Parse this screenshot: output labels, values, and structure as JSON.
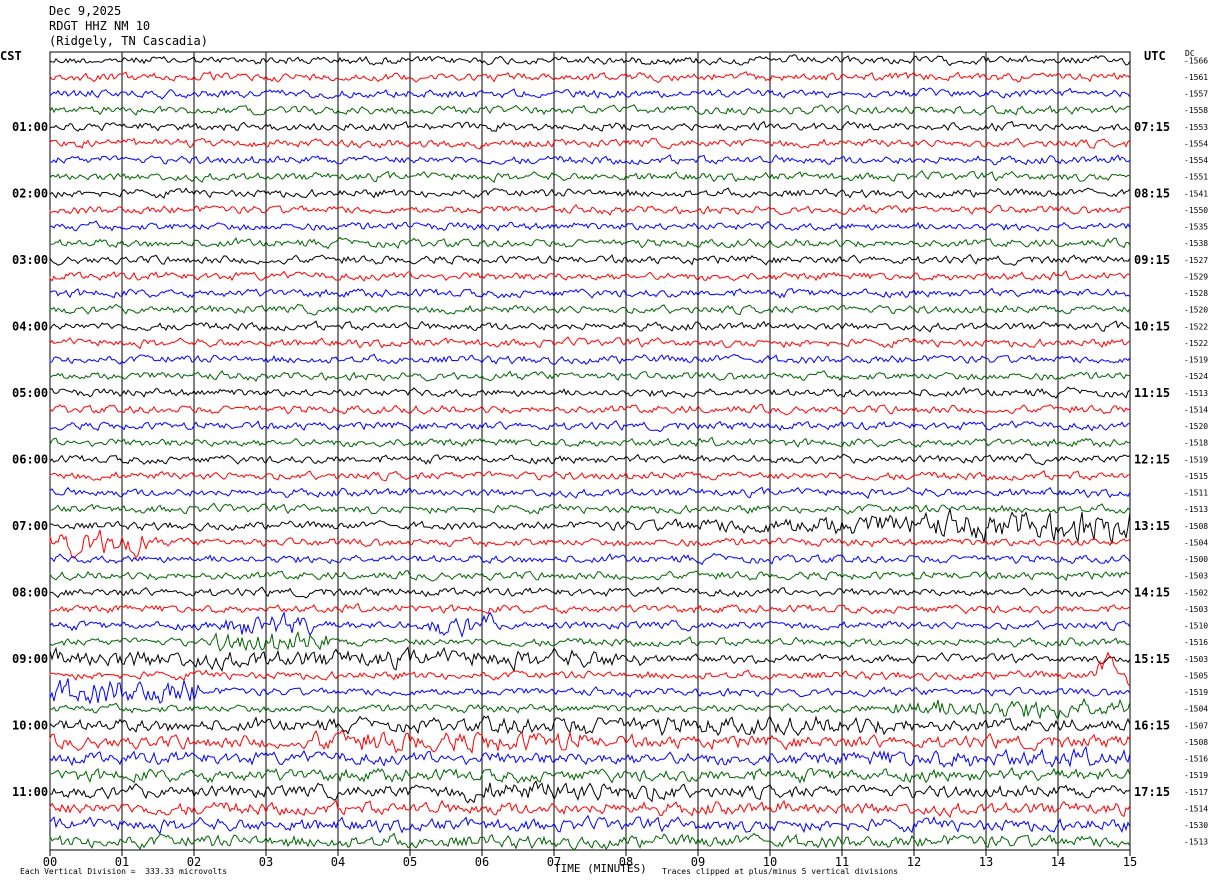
{
  "header": {
    "date": "Dec 9,2025",
    "station": "RDGT HHZ NM 10",
    "location": "(Ridgely, TN Cascadia)"
  },
  "left_zone": "CST",
  "right_zone": "UTC",
  "dc_label": "DC",
  "footer": {
    "left_note": "Each Vertical Division =  333.33 microvolts",
    "axis_title": "TIME (MINUTES)",
    "right_note": "Traces clipped at plus/minus 5 vertical divisions"
  },
  "colors": {
    "cycle": [
      "#000000",
      "#ff0000",
      "#0000ff",
      "#006400"
    ]
  },
  "chart_data": {
    "type": "line",
    "title": "Dec 9,2025 RDGT HHZ NM 10 (Ridgely, TN Cascadia)",
    "xlabel": "TIME (MINUTES)",
    "xlim": [
      0,
      15
    ],
    "x_ticks": [
      "00",
      "01",
      "02",
      "03",
      "04",
      "05",
      "06",
      "07",
      "08",
      "09",
      "10",
      "11",
      "12",
      "13",
      "14",
      "15"
    ],
    "rows_per_hour": 4,
    "row_count": 48,
    "left_hour_labels": [
      "01:00",
      "02:00",
      "03:00",
      "04:00",
      "05:00",
      "06:00",
      "07:00",
      "08:00",
      "09:00",
      "10:00",
      "11:00"
    ],
    "right_hour_labels": [
      "07:15",
      "08:15",
      "09:15",
      "10:15",
      "11:15",
      "12:15",
      "13:15",
      "14:15",
      "15:15",
      "16:15",
      "17:15"
    ],
    "hour_label_rows": [
      4,
      8,
      12,
      16,
      20,
      24,
      28,
      32,
      36,
      40,
      44
    ],
    "dc_offsets": [
      -1566,
      -1561,
      -1557,
      -1558,
      -1553,
      -1554,
      -1554,
      -1551,
      -1541,
      -1550,
      -1535,
      -1538,
      -1527,
      -1529,
      -1528,
      -1520,
      -1522,
      -1522,
      -1519,
      -1524,
      -1513,
      -1514,
      -1520,
      -1518,
      -1519,
      -1515,
      -1511,
      -1513,
      -1508,
      -1504,
      -1500,
      -1503,
      -1502,
      -1503,
      -1510,
      -1516,
      -1503,
      -1505,
      -1519,
      -1504,
      -1507,
      -1508,
      -1516,
      -1519,
      -1517,
      -1514,
      -1530,
      -1513
    ],
    "vertical_division_microvolts": 333.33,
    "clip_divisions": 5
  }
}
